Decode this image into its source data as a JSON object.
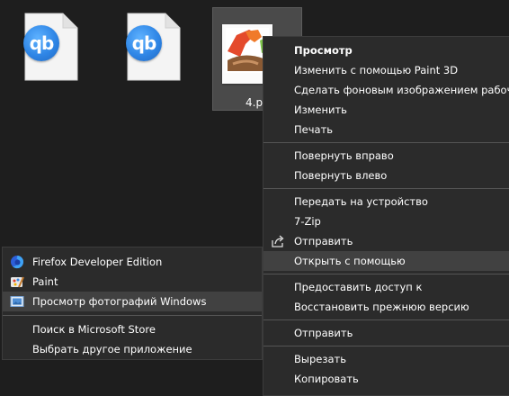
{
  "desktop": {
    "files": [
      {
        "icon": "qbittorrent-icon",
        "text": "qb"
      },
      {
        "icon": "qbittorrent-icon",
        "text": "qb"
      },
      {
        "icon": "image-file-icon",
        "label": "4.p"
      }
    ]
  },
  "context_menu": {
    "items": [
      {
        "label": "Просмотр",
        "bold": true
      },
      {
        "label": "Изменить с помощью Paint 3D"
      },
      {
        "label": "Сделать фоновым изображением рабочего стола"
      },
      {
        "label": "Изменить"
      },
      {
        "label": "Печать"
      },
      {
        "separator": true
      },
      {
        "label": "Повернуть вправо"
      },
      {
        "label": "Повернуть влево"
      },
      {
        "separator": true
      },
      {
        "label": "Передать на устройство"
      },
      {
        "label": "7-Zip"
      },
      {
        "label": "Отправить",
        "icon": "share-icon"
      },
      {
        "label": "Открыть с помощью",
        "highlighted": true
      },
      {
        "separator": true
      },
      {
        "label": "Предоставить доступ к"
      },
      {
        "label": "Восстановить прежнюю версию"
      },
      {
        "separator": true
      },
      {
        "label": "Отправить"
      },
      {
        "separator": true
      },
      {
        "label": "Вырезать"
      },
      {
        "label": "Копировать"
      }
    ]
  },
  "open_with_menu": {
    "items": [
      {
        "label": "Firefox Developer Edition",
        "icon": "firefox-icon"
      },
      {
        "label": "Paint",
        "icon": "paint-icon"
      },
      {
        "label": "Просмотр фотографий Windows",
        "icon": "photo-viewer-icon",
        "highlighted": true
      },
      {
        "separator": true
      },
      {
        "label": "Поиск в Microsoft Store"
      },
      {
        "label": "Выбрать другое приложение"
      }
    ]
  },
  "colors": {
    "menu_bg": "#2b2b2b",
    "hover_bg": "#414141",
    "desktop_bg": "#1e1e1e",
    "text": "#ffffff"
  }
}
